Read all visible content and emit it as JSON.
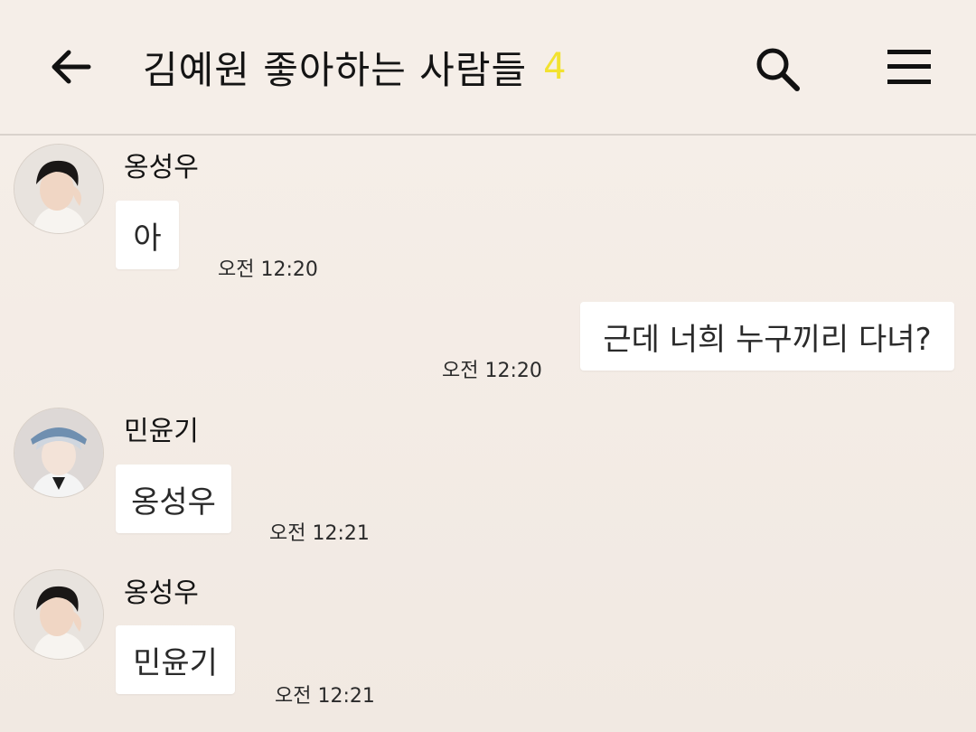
{
  "header": {
    "title": "김예원 좋아하는 사람들",
    "member_count": "4"
  },
  "messages": [
    {
      "sender": "옹성우",
      "text": "아",
      "time": "오전 12:20",
      "outgoing": false
    },
    {
      "text": "근데 너희 누구끼리 다녀?",
      "time": "오전 12:20",
      "outgoing": true
    },
    {
      "sender": "민윤기",
      "text": "옹성우",
      "time": "오전 12:21",
      "outgoing": false
    },
    {
      "sender": "옹성우",
      "text": "민윤기",
      "time": "오전 12:21",
      "outgoing": false
    }
  ],
  "colors": {
    "background": "#f3ece6",
    "count_accent": "#f2e230",
    "bubble": "#ffffff"
  }
}
